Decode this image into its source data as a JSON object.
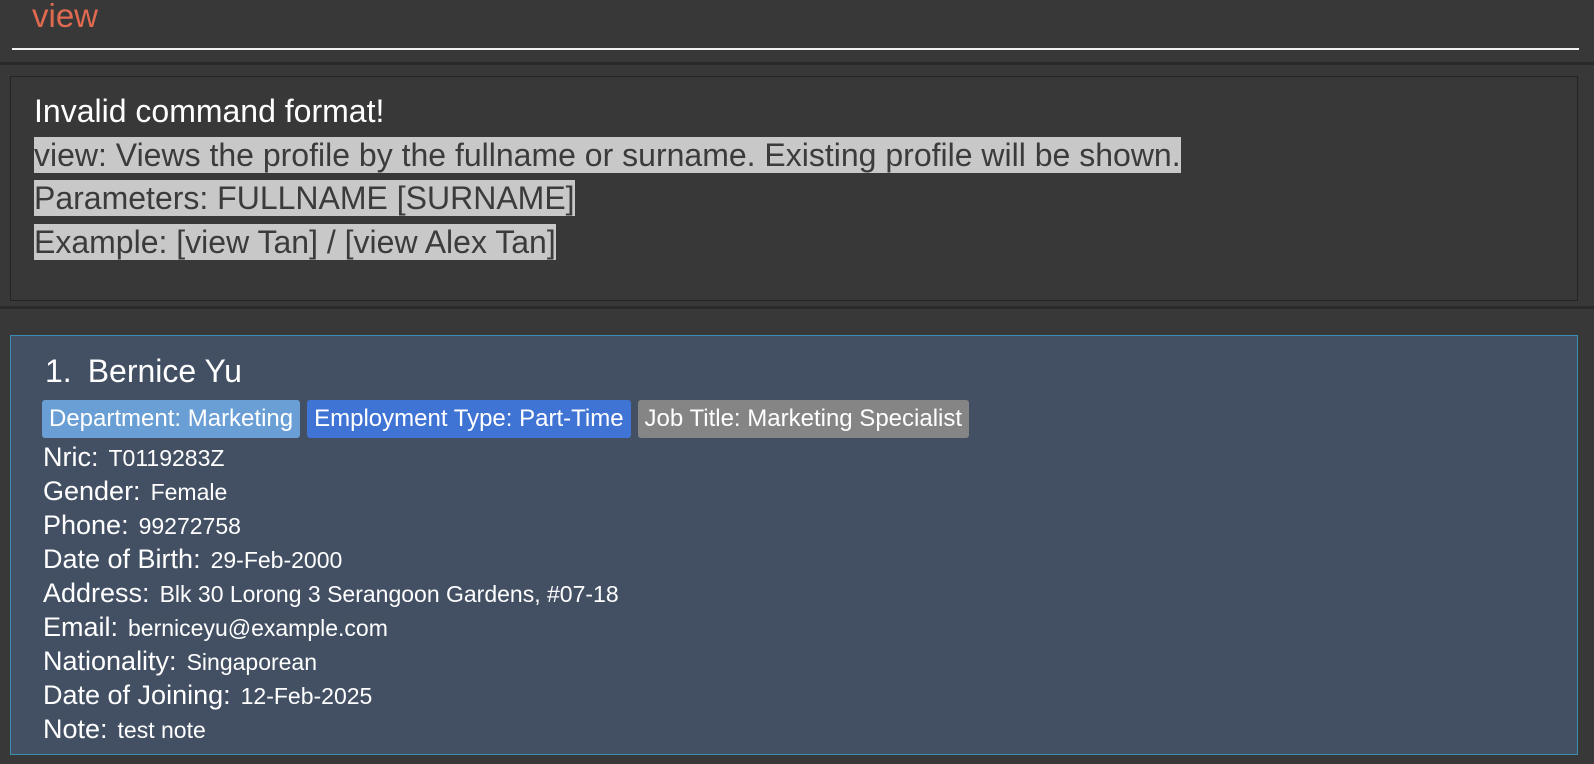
{
  "command": {
    "text": "view"
  },
  "result": {
    "headline": "Invalid command format!",
    "lines": [
      "view: Views the profile by the fullname or surname. Existing profile will be shown.",
      "Parameters: FULLNAME [SURNAME]",
      "Example: [view Tan] / [view Alex Tan]"
    ]
  },
  "person": {
    "index": "1.",
    "name": "Bernice Yu",
    "tags": {
      "department": "Department: Marketing",
      "employment": "Employment Type: Part-Time",
      "job": "Job Title: Marketing Specialist"
    },
    "fields": [
      {
        "label": "Nric:",
        "value": "T0119283Z"
      },
      {
        "label": "Gender:",
        "value": "Female"
      },
      {
        "label": "Phone:",
        "value": "99272758"
      },
      {
        "label": "Date of Birth:",
        "value": "29-Feb-2000"
      },
      {
        "label": "Address:",
        "value": "Blk 30 Lorong 3 Serangoon Gardens, #07-18"
      },
      {
        "label": "Email:",
        "value": "berniceyu@example.com"
      },
      {
        "label": "Nationality:",
        "value": "Singaporean"
      },
      {
        "label": "Date of Joining:",
        "value": "12-Feb-2025"
      },
      {
        "label": "Note:",
        "value": "test note"
      }
    ]
  },
  "colors": {
    "command_text": "#e06a50",
    "card_background": "#435064",
    "card_border": "#3c8db3",
    "tag_department": "#6a9fd6",
    "tag_employment": "#3f74d4",
    "tag_job": "#858585"
  }
}
